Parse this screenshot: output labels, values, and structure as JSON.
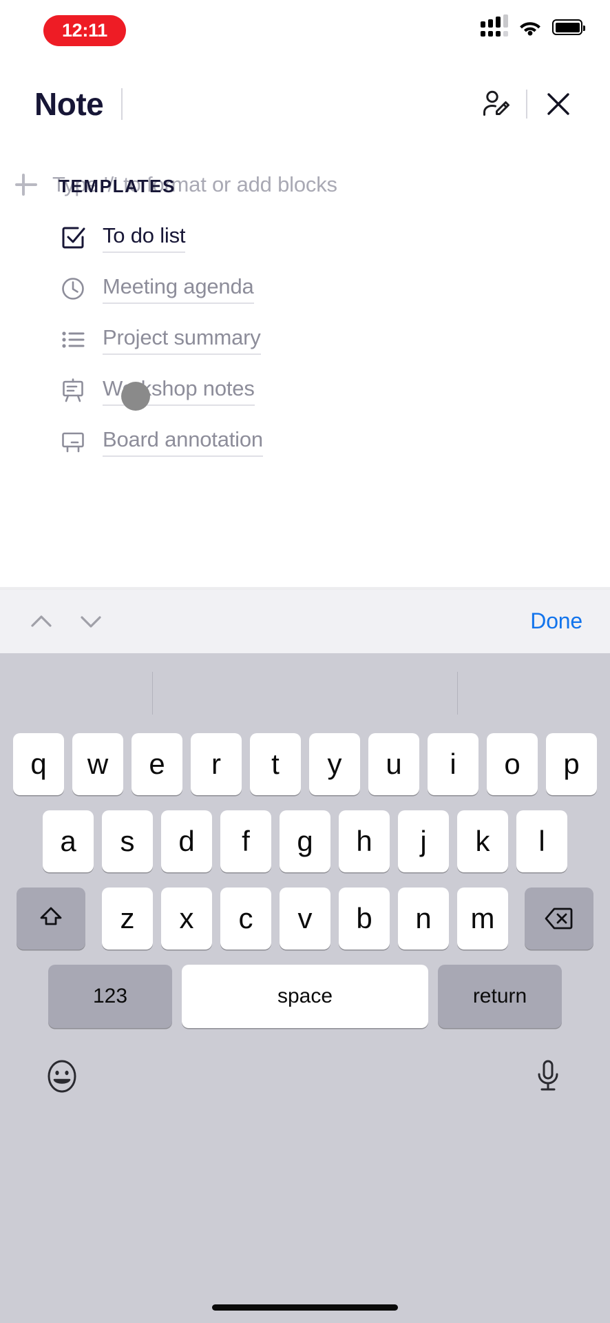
{
  "status_bar": {
    "time": "12:11",
    "recording_pill_color": "#ee1c25",
    "signal_icon": "cellular-signal-icon",
    "wifi_icon": "wifi-icon",
    "battery_icon": "battery-icon"
  },
  "header": {
    "title": "Note",
    "collaborate_icon": "person-edit-icon",
    "close_icon": "close-icon"
  },
  "note": {
    "add_block_icon": "plus-icon",
    "placeholder": "Type '/' to format or add blocks",
    "templates_label": "TEMPLATES",
    "templates": [
      {
        "label": "To do list",
        "icon": "checkbox-icon",
        "active": true
      },
      {
        "label": "Meeting agenda",
        "icon": "clock-icon",
        "active": false
      },
      {
        "label": "Project summary",
        "icon": "bullet-list-icon",
        "active": false
      },
      {
        "label": "Workshop notes",
        "icon": "easel-icon",
        "active": false
      },
      {
        "label": "Board annotation",
        "icon": "whiteboard-icon",
        "active": false
      }
    ]
  },
  "accessory_toolbar": {
    "prev_icon": "chevron-up-icon",
    "next_icon": "chevron-down-icon",
    "done_label": "Done",
    "done_color": "#1274ec"
  },
  "keyboard": {
    "row1": [
      "q",
      "w",
      "e",
      "r",
      "t",
      "y",
      "u",
      "i",
      "o",
      "p"
    ],
    "row2": [
      "a",
      "s",
      "d",
      "f",
      "g",
      "h",
      "j",
      "k",
      "l"
    ],
    "row3": [
      "z",
      "x",
      "c",
      "v",
      "b",
      "n",
      "m"
    ],
    "shift_icon": "shift-icon",
    "delete_icon": "backspace-icon",
    "numbers_label": "123",
    "space_label": "space",
    "return_label": "return",
    "emoji_icon": "emoji-icon",
    "dictation_icon": "microphone-icon"
  }
}
